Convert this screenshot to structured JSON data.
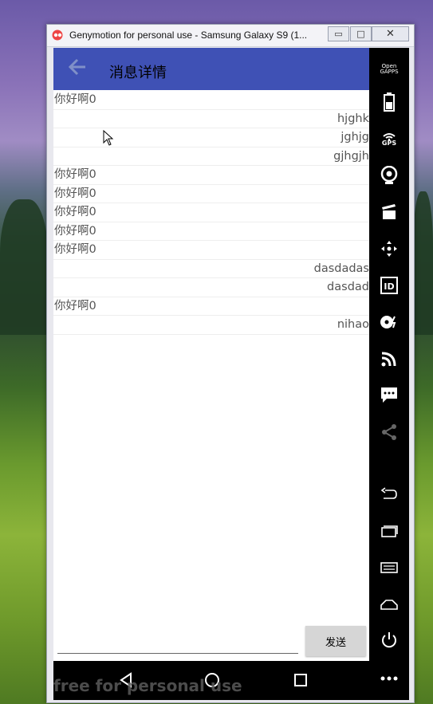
{
  "window": {
    "title": "Genymotion for personal use - Samsung Galaxy S9 (1...",
    "min_label": "▭",
    "max_label": "□",
    "close_label": "✕"
  },
  "app": {
    "page_title": "消息详情",
    "messages": [
      {
        "text": "你好啊0",
        "align": "left"
      },
      {
        "text": "hjghk",
        "align": "right"
      },
      {
        "text": "jghjg",
        "align": "right"
      },
      {
        "text": "gjhgjh",
        "align": "right"
      },
      {
        "text": "你好啊0",
        "align": "left"
      },
      {
        "text": "你好啊0",
        "align": "left"
      },
      {
        "text": "你好啊0",
        "align": "left"
      },
      {
        "text": "你好啊0",
        "align": "left"
      },
      {
        "text": "你好啊0",
        "align": "left"
      },
      {
        "text": "dasdadas",
        "align": "right"
      },
      {
        "text": "dasdad",
        "align": "right"
      },
      {
        "text": "你好啊0",
        "align": "left"
      },
      {
        "text": "nihao",
        "align": "right"
      }
    ],
    "input_value": "",
    "send_label": "发送"
  },
  "watermark": "free for personal use",
  "sidebar": {
    "gapps_label_top": "Open",
    "gapps_label_bottom": "GAPPS",
    "gps_label": "GPS",
    "id_label": "ID"
  },
  "colors": {
    "app_bar": "#3f51b5",
    "send_button": "#d6d6d6"
  }
}
